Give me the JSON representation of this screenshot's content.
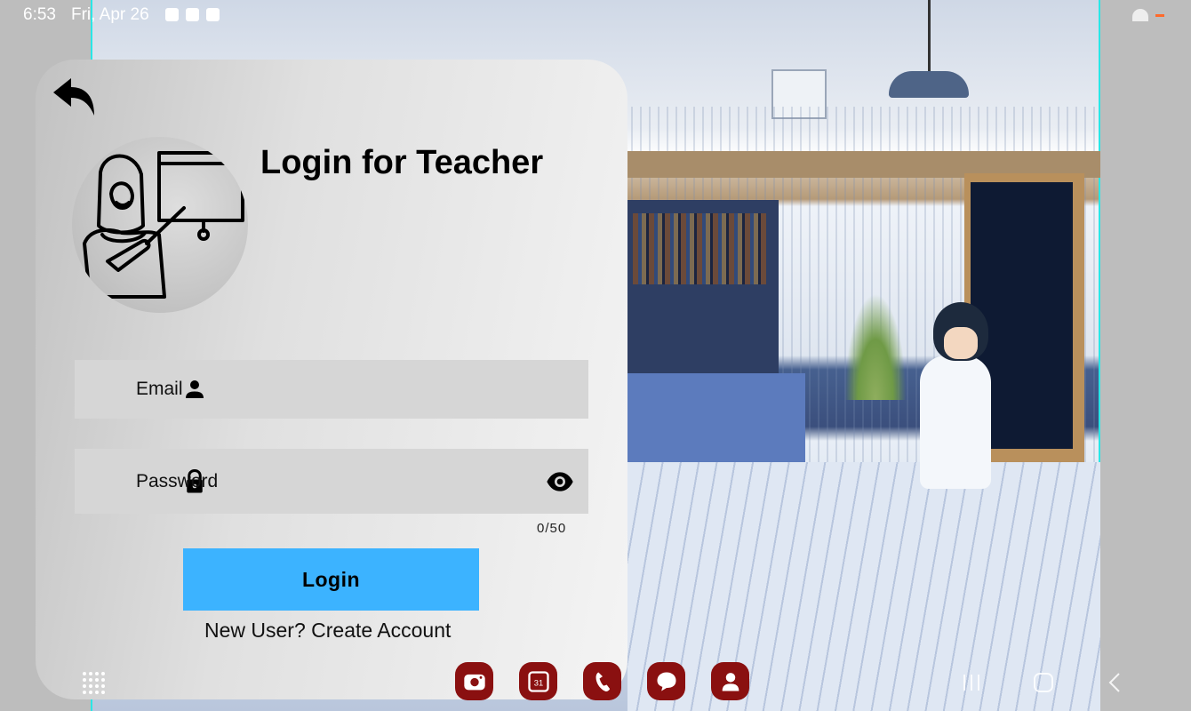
{
  "status_bar": {
    "time": "6:53",
    "date": "Fri, Apr 26",
    "notification_icons": [
      "gallery-icon",
      "alert-icon",
      "app-icon"
    ],
    "battery_color": "#ff6a2a"
  },
  "login_card": {
    "back_icon": "back-arrow-icon",
    "avatar_icon": "teacher-icon",
    "title": "Login for Teacher",
    "email": {
      "placeholder": "Email",
      "value": "",
      "icon": "person-icon"
    },
    "password": {
      "placeholder": "Password",
      "value": "",
      "icon": "lock-icon",
      "toggle_icon": "eye-icon"
    },
    "char_counter": "0/50",
    "login_button": "Login",
    "create_account_link": "New User? Create Account",
    "accent_color": "#3cb3ff"
  },
  "taskbar": {
    "apps_icon": "apps-grid-icon",
    "dock_apps": [
      {
        "name": "camera-icon",
        "label": ""
      },
      {
        "name": "calendar-icon",
        "label": "31"
      },
      {
        "name": "phone-icon",
        "label": ""
      },
      {
        "name": "messages-icon",
        "label": ""
      },
      {
        "name": "contacts-icon",
        "label": ""
      }
    ],
    "dock_color": "#8a1010",
    "nav": [
      "recents-icon",
      "home-icon",
      "back-icon"
    ]
  }
}
